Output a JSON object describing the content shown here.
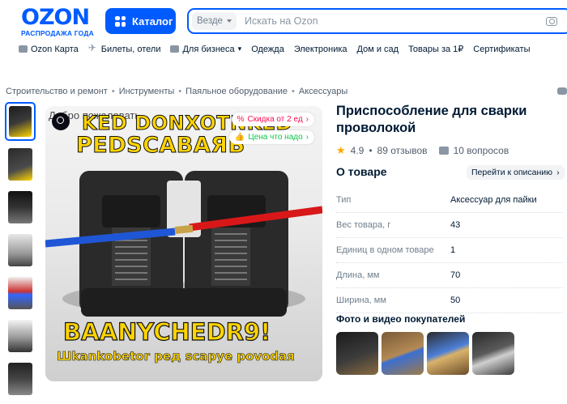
{
  "header": {
    "logo_text": "OZON",
    "logo_subtitle": "РАСПРОДАЖА ГОДА",
    "catalog_label": "Каталог",
    "search_scope": "Везде",
    "search_placeholder": "Искать на Ozon"
  },
  "nav": {
    "items": [
      "Ozon Карта",
      "Билеты, отели",
      "Для бизнеса",
      "Одежда",
      "Электроника",
      "Дом и сад",
      "Товары за 1₽",
      "Сертификаты"
    ]
  },
  "breadcrumbs": [
    "Строительство и ремонт",
    "Инструменты",
    "Паяльное оборудование",
    "Аксессуары"
  ],
  "product": {
    "title": "Приспособление для сварки проволокой",
    "rating": "4.9",
    "reviews": "89 отзывов",
    "questions": "10 вопросов",
    "image_brand": "Добро пожаловать",
    "image_text_top1": "KED DONXOTNKED",
    "image_text_top2": "PEDSCABAЯЬ",
    "image_text_bottom1": "BAANYCHEDR9!",
    "image_text_bottom2": "Шkankobetor peд scapye povodaя",
    "badge_discount": "Скидка от 2 ед",
    "badge_price": "Цена что надо"
  },
  "about": {
    "heading": "О товаре",
    "to_description": "Перейти к описанию",
    "specs": [
      {
        "key": "Тип",
        "value": "Аксессуар для пайки"
      },
      {
        "key": "Вес товара, г",
        "value": "43"
      },
      {
        "key": "Единиц в одном товаре",
        "value": "1"
      },
      {
        "key": "Длина, мм",
        "value": "70"
      },
      {
        "key": "Ширина, мм",
        "value": "50"
      }
    ]
  },
  "customer_media": {
    "heading": "Фото и видео покупателей"
  },
  "colors": {
    "brand": "#005bff",
    "accent_pink": "#f91155",
    "accent_green": "#10c44c",
    "star": "#ffa800"
  }
}
